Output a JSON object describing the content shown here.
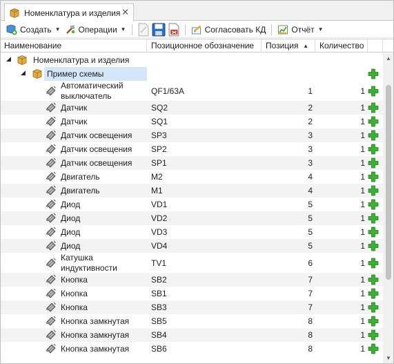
{
  "tab": {
    "label": "Номенклатура и изделия",
    "close": "✕"
  },
  "toolbar": {
    "create_label": "Создать",
    "operations_label": "Операции",
    "approve_label": "Согласовать КД",
    "report_label": "Отчёт"
  },
  "columns": {
    "name": "Наименование",
    "designation": "Позиционное обозначение",
    "position": "Позиция",
    "quantity": "Количество"
  },
  "tree": {
    "root_label": "Номенклатура и изделия",
    "group_label": "Пример схемы"
  },
  "rows": [
    {
      "name_line1": "Автоматический",
      "name_line2": "выключатель",
      "code": "QF1/63A",
      "pos": "1",
      "qty": "1"
    },
    {
      "name_line1": "Датчик",
      "name_line2": "",
      "code": "SQ2",
      "pos": "2",
      "qty": "1"
    },
    {
      "name_line1": "Датчик",
      "name_line2": "",
      "code": "SQ1",
      "pos": "2",
      "qty": "1"
    },
    {
      "name_line1": "Датчик освещения",
      "name_line2": "",
      "code": "SP3",
      "pos": "3",
      "qty": "1"
    },
    {
      "name_line1": "Датчик освещения",
      "name_line2": "",
      "code": "SP2",
      "pos": "3",
      "qty": "1"
    },
    {
      "name_line1": "Датчик освещения",
      "name_line2": "",
      "code": "SP1",
      "pos": "3",
      "qty": "1"
    },
    {
      "name_line1": "Двигатель",
      "name_line2": "",
      "code": "M2",
      "pos": "4",
      "qty": "1"
    },
    {
      "name_line1": "Двигатель",
      "name_line2": "",
      "code": "M1",
      "pos": "4",
      "qty": "1"
    },
    {
      "name_line1": "Диод",
      "name_line2": "",
      "code": "VD1",
      "pos": "5",
      "qty": "1"
    },
    {
      "name_line1": "Диод",
      "name_line2": "",
      "code": "VD2",
      "pos": "5",
      "qty": "1"
    },
    {
      "name_line1": "Диод",
      "name_line2": "",
      "code": "VD3",
      "pos": "5",
      "qty": "1"
    },
    {
      "name_line1": "Диод",
      "name_line2": "",
      "code": "VD4",
      "pos": "5",
      "qty": "1"
    },
    {
      "name_line1": "Катушка",
      "name_line2": "индуктивности",
      "code": "TV1",
      "pos": "6",
      "qty": "1"
    },
    {
      "name_line1": "Кнопка",
      "name_line2": "",
      "code": "SB2",
      "pos": "7",
      "qty": "1"
    },
    {
      "name_line1": "Кнопка",
      "name_line2": "",
      "code": "SB1",
      "pos": "7",
      "qty": "1"
    },
    {
      "name_line1": "Кнопка",
      "name_line2": "",
      "code": "SB3",
      "pos": "7",
      "qty": "1"
    },
    {
      "name_line1": "Кнопка замкнутая",
      "name_line2": "",
      "code": "SB5",
      "pos": "8",
      "qty": "1"
    },
    {
      "name_line1": "Кнопка замкнутая",
      "name_line2": "",
      "code": "SB4",
      "pos": "8",
      "qty": "1"
    },
    {
      "name_line1": "Кнопка замкнутая",
      "name_line2": "",
      "code": "SB6",
      "pos": "8",
      "qty": "1"
    }
  ],
  "icons": {
    "tab": "package-icon",
    "create": "create-icon",
    "operations": "operations-icon",
    "edit": "edit-document-icon",
    "save": "save-icon",
    "pdf": "pdf-export-icon",
    "approve": "approve-icon",
    "report": "report-chart-icon",
    "item": "component-icon",
    "add": "add-icon"
  },
  "colors": {
    "accent_add": "#3cb034",
    "selection": "#d5e6f8",
    "package": "#d9a23a"
  }
}
